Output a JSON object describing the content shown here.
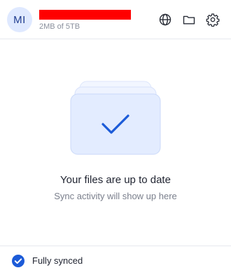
{
  "header": {
    "avatar_initials": "MI",
    "storage_text": "2MB of 5TB",
    "buttons": [
      {
        "icon": "globe-icon"
      },
      {
        "icon": "folder-icon"
      },
      {
        "icon": "gear-icon"
      }
    ]
  },
  "empty_state": {
    "title": "Your files are up to date",
    "subtitle": "Sync activity will show up here"
  },
  "footer": {
    "status_label": "Fully synced",
    "status_color": "#1c5bd8"
  },
  "colors": {
    "accent": "#1c5bd8",
    "redaction": "#ff0000"
  }
}
